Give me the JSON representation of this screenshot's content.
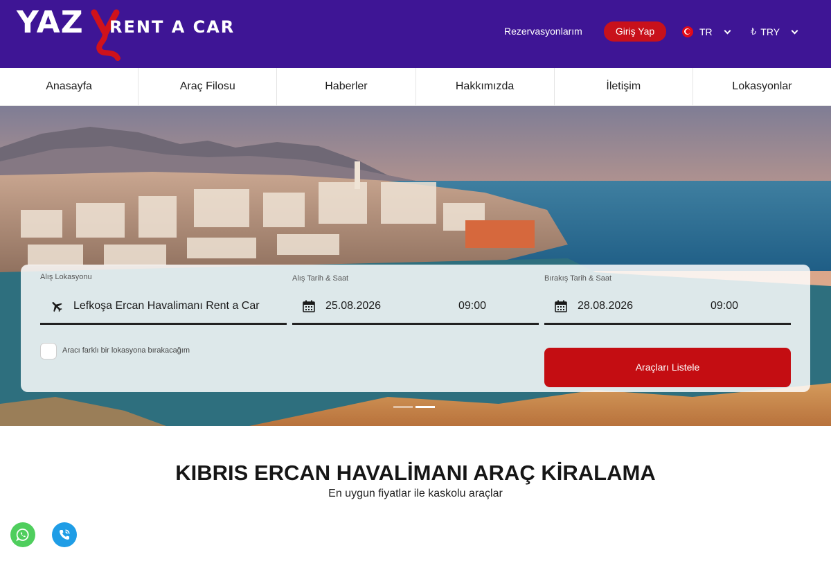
{
  "brand": {
    "logo_main": "YAZ",
    "logo_sub": "RENT A CAR",
    "primary_color": "#3e1595",
    "accent_color": "#c8111b"
  },
  "header": {
    "reservations": "Rezervasyonlarım",
    "login": "Giriş Yap",
    "language": "TR",
    "currency": "TRY",
    "icons": [
      "turkey-flag-icon",
      "chevron-down-icon",
      "lira-icon"
    ]
  },
  "nav": {
    "items": [
      {
        "label": "Anasayfa"
      },
      {
        "label": "Araç Filosu"
      },
      {
        "label": "Haberler"
      },
      {
        "label": "Hakkımızda"
      },
      {
        "label": "İletişim"
      },
      {
        "label": "Lokasyonlar"
      }
    ]
  },
  "search": {
    "pickup_location_label": "Alış Lokasyonu",
    "pickup_location_value": "Lefkoşa Ercan Havalimanı Rent a Car",
    "pickup_datetime_label": "Alış Tarih & Saat",
    "pickup_date": "25.08.2026",
    "pickup_time": "09:00",
    "dropoff_datetime_label": "Bırakış Tarih & Saat",
    "dropoff_date": "28.08.2026",
    "dropoff_time": "09:00",
    "different_location_label": "Aracı farklı bir lokasyona bırakacağım",
    "different_location_checked": false,
    "submit_label": "Araçları Listele",
    "icons": [
      "airplane-icon",
      "calendar-icon"
    ]
  },
  "slider": {
    "slide_count": 2,
    "active_slide": 2
  },
  "section": {
    "title": "KIBRIS ERCAN HAVALİMANI ARAÇ KİRALAMA",
    "subtitle": "En uygun fiyatlar ile kaskolu araçlar"
  },
  "floating_buttons": {
    "whatsapp_color": "#4fce5d",
    "phone_color": "#1f9de6"
  }
}
